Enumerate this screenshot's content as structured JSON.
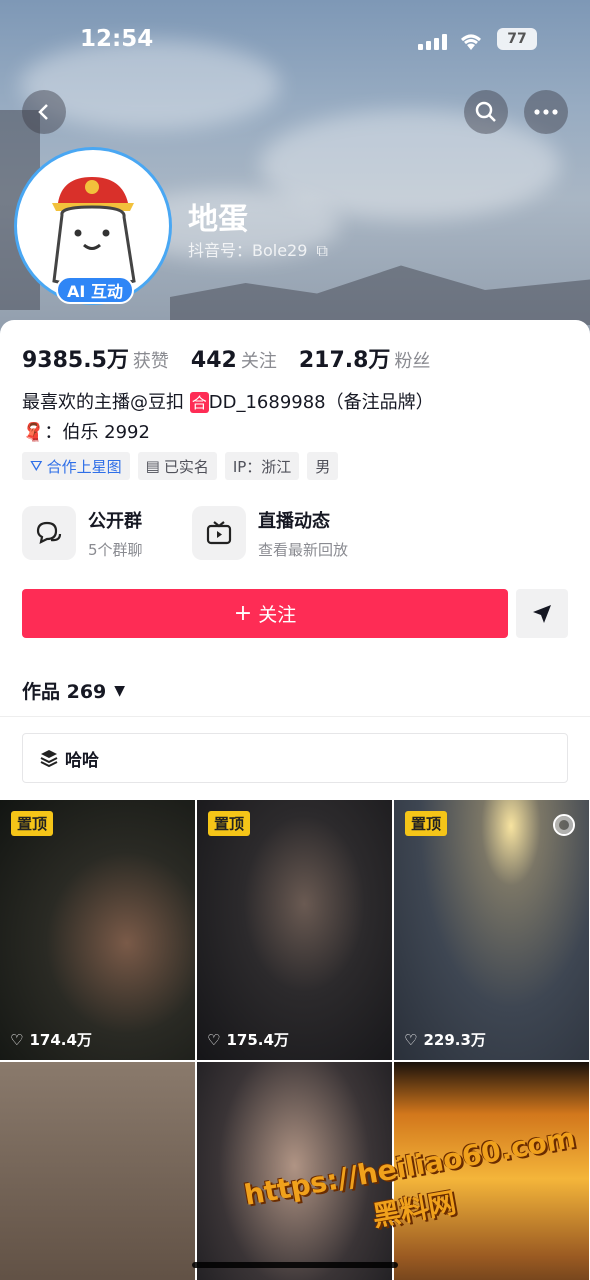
{
  "status_bar": {
    "time": "12:54",
    "battery": "77"
  },
  "profile": {
    "name": "地蛋",
    "douyin_id": "抖音号：Bole29",
    "ai_badge": "AI 互动",
    "stats": [
      {
        "value": "9385.5万",
        "label": "获赞"
      },
      {
        "value": "442",
        "label": "关注"
      },
      {
        "value": "217.8万",
        "label": "粉丝"
      }
    ],
    "bio_line1_prefix": "最喜欢的主播@豆扣 ",
    "bio_line1_badge": "合",
    "bio_line1_suffix": "DD_1689988（备注品牌）",
    "bio_line2": "：伯乐 2992",
    "tags": [
      "合作上星图",
      "已实名",
      "IP：浙江",
      "男"
    ]
  },
  "services": [
    {
      "title": "公开群",
      "subtitle": "5个群聊",
      "icon": "chat-bubble-icon"
    },
    {
      "title": "直播动态",
      "subtitle": "查看最新回放",
      "icon": "tv-icon"
    }
  ],
  "actions": {
    "follow_label": "关注"
  },
  "works": {
    "label": "作品 269"
  },
  "collection": {
    "label": "哈哈"
  },
  "videos": [
    {
      "pinned": "置顶",
      "likes": "174.4万"
    },
    {
      "pinned": "置顶",
      "likes": "175.4万"
    },
    {
      "pinned": "置顶",
      "likes": "229.3万"
    },
    {
      "pinned": "",
      "likes": ""
    },
    {
      "pinned": "",
      "likes": ""
    },
    {
      "pinned": "",
      "likes": ""
    }
  ],
  "watermark": {
    "line1": "https://heiliao60.com",
    "line2": "黑料网"
  },
  "colors": {
    "accent": "#fe2c55",
    "pin": "#f5c518",
    "ai_badge": "#2f86f6"
  }
}
